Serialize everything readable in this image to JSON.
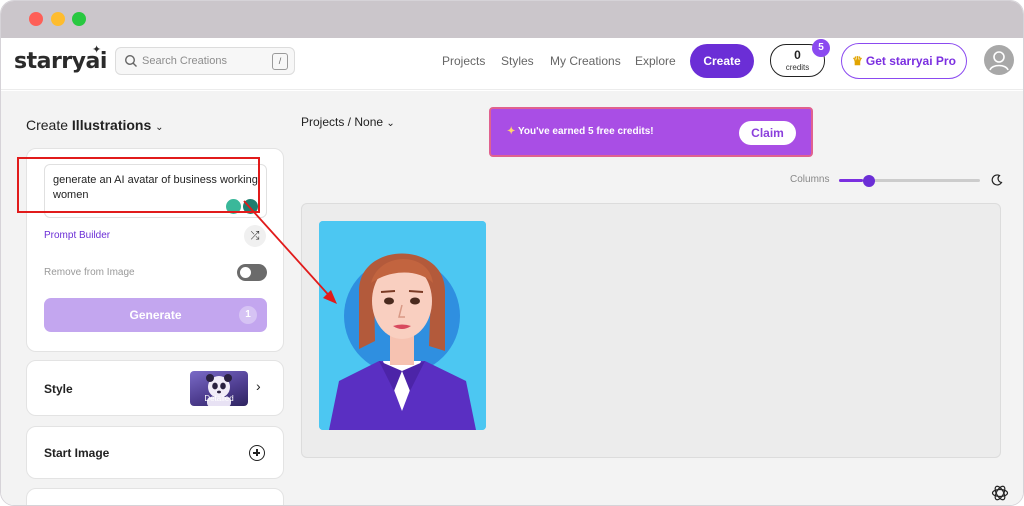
{
  "app": {
    "logo": "starryai",
    "search_placeholder": "Search Creations",
    "search_shortcut": "/"
  },
  "nav": {
    "links": [
      "Projects",
      "Styles",
      "My Creations",
      "Explore"
    ],
    "create_label": "Create",
    "credits_count": "0",
    "credits_label": "credits",
    "credits_badge": "5",
    "pro_label": "Get starryai Pro"
  },
  "sidebar": {
    "create_prefix": "Create",
    "create_mode": "Illustrations",
    "prompt": "generate an AI avatar of business working women",
    "prompt_builder": "Prompt Builder",
    "remove_from_image": "Remove from Image",
    "remove_from_image_on": false,
    "generate_label": "Generate",
    "generate_count": "1",
    "style_label": "Style",
    "style_thumb_caption": "Detailed",
    "start_image_label": "Start Image"
  },
  "main": {
    "breadcrumb": "Projects / None",
    "banner_text": "You've earned 5 free credits!",
    "claim_label": "Claim",
    "columns_label": "Columns",
    "columns_level": 0.2
  },
  "colors": {
    "accent": "#6b2ed6",
    "banner": "#a94ee5",
    "annotation": "#e11b1b"
  },
  "icons": [
    "search-icon",
    "user-icon",
    "crown-icon",
    "bulb-icon",
    "shuffle-icon",
    "chevron-right-icon",
    "plus-circle-icon",
    "moon-icon",
    "openai-icon"
  ]
}
